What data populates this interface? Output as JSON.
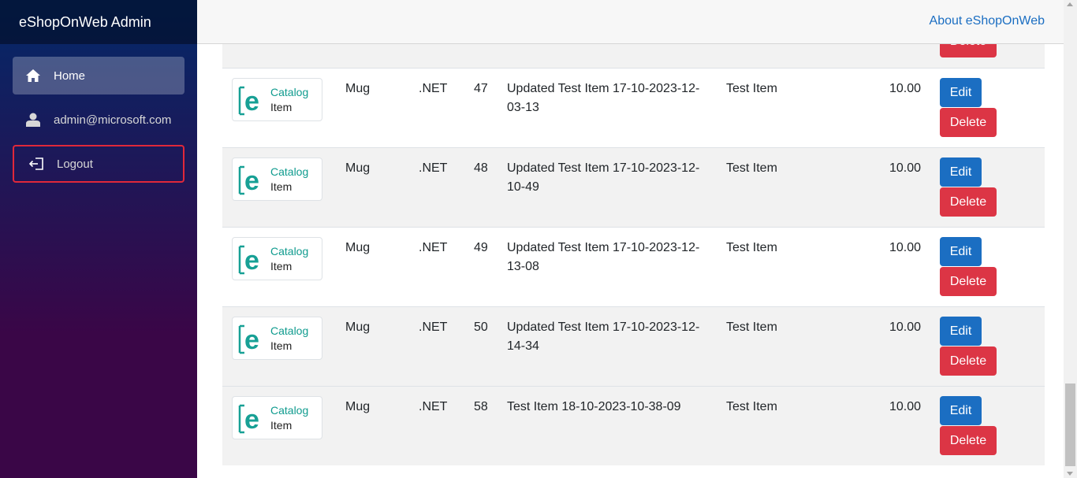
{
  "sidebar": {
    "brand": "eShopOnWeb Admin",
    "items": [
      {
        "label": "Home",
        "icon": "home-icon"
      },
      {
        "label": "admin@microsoft.com",
        "icon": "user-icon"
      },
      {
        "label": "Logout",
        "icon": "logout-icon"
      }
    ]
  },
  "topbar": {
    "about_link": "About eShopOnWeb"
  },
  "table": {
    "partial_delete_label": "Delete",
    "image_text_1": "Catalog",
    "image_text_2": "Item",
    "rows": [
      {
        "type": "Mug",
        "brand": ".NET",
        "id": "47",
        "name": "Updated Test Item 17-10-2023-12-03-13",
        "description": "Test Item",
        "price": "10.00",
        "edit": "Edit",
        "delete": "Delete"
      },
      {
        "type": "Mug",
        "brand": ".NET",
        "id": "48",
        "name": "Updated Test Item 17-10-2023-12-10-49",
        "description": "Test Item",
        "price": "10.00",
        "edit": "Edit",
        "delete": "Delete"
      },
      {
        "type": "Mug",
        "brand": ".NET",
        "id": "49",
        "name": "Updated Test Item 17-10-2023-12-13-08",
        "description": "Test Item",
        "price": "10.00",
        "edit": "Edit",
        "delete": "Delete"
      },
      {
        "type": "Mug",
        "brand": ".NET",
        "id": "50",
        "name": "Updated Test Item 17-10-2023-12-14-34",
        "description": "Test Item",
        "price": "10.00",
        "edit": "Edit",
        "delete": "Delete"
      },
      {
        "type": "Mug",
        "brand": ".NET",
        "id": "58",
        "name": "Test Item 18-10-2023-10-38-09",
        "description": "Test Item",
        "price": "10.00",
        "edit": "Edit",
        "delete": "Delete"
      }
    ]
  },
  "colors": {
    "edit_button": "#1b6ec2",
    "delete_button": "#dc3545",
    "logout_border": "#e0283a"
  }
}
